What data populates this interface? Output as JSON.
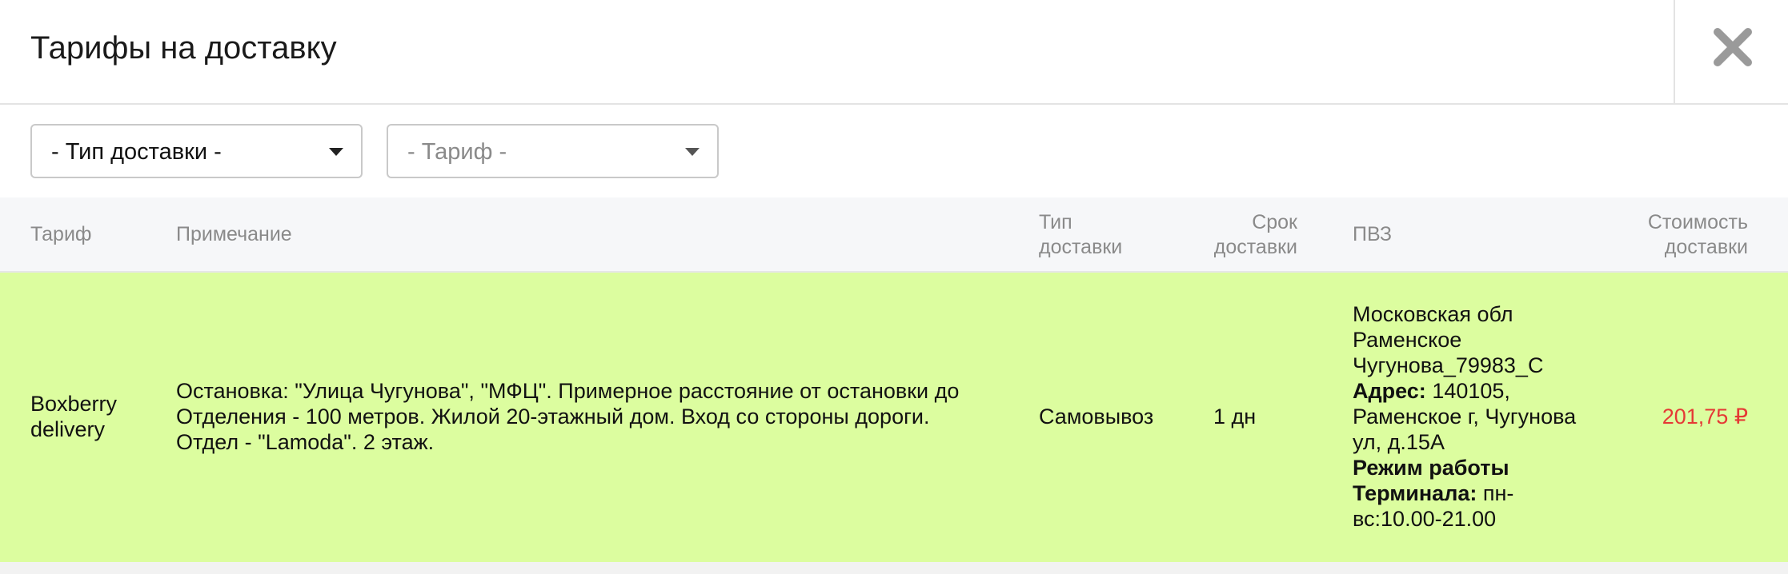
{
  "modal": {
    "title": "Тарифы на доставку"
  },
  "filters": {
    "delivery_type": {
      "selected": "- Тип доставки -"
    },
    "tariff": {
      "selected": "- Тариф -"
    }
  },
  "table": {
    "headers": {
      "tariff": "Тариф",
      "note": "Примечание",
      "type_line1": "Тип",
      "type_line2": "доставки",
      "term_line1": "Срок",
      "term_line2": "доставки",
      "pvz": "ПВЗ",
      "cost_line1": "Стоимость",
      "cost_line2": "доставки"
    },
    "rows": [
      {
        "tariff_line1": "Boxberry",
        "tariff_line2": "delivery",
        "note_line1": "Остановка: \"Улица Чугунова\", \"МФЦ\". Примерное расстояние от остановки до",
        "note_line2": "Отделения - 100 метров. Жилой 20-этажный дом. Вход со стороны дороги.",
        "note_line3": "Отдел - \"Lamoda\". 2 этаж.",
        "type": "Самовывоз",
        "term": "1 дн",
        "pvz_line1": "Московская обл",
        "pvz_line2": "Раменское",
        "pvz_line3": "Чугунова_79983_С",
        "pvz_address_label": "Адрес:",
        "pvz_address_line1": " 140105,",
        "pvz_address_line2": "Раменское г, Чугунова",
        "pvz_address_line3": "ул, д.15А",
        "pvz_hours_label_line1": "Режим работы",
        "pvz_hours_label_line2": "Терминала:",
        "pvz_hours_line1": " пн-",
        "pvz_hours_line2": "вс:10.00-21.00",
        "cost": "201,75 ₽"
      }
    ]
  },
  "colors": {
    "row_highlight": "#dcfd9f",
    "price": "#e53935",
    "header_bg": "#f6f7f9"
  },
  "icons": {
    "close": "close-icon",
    "caret": "chevron-down-icon"
  }
}
